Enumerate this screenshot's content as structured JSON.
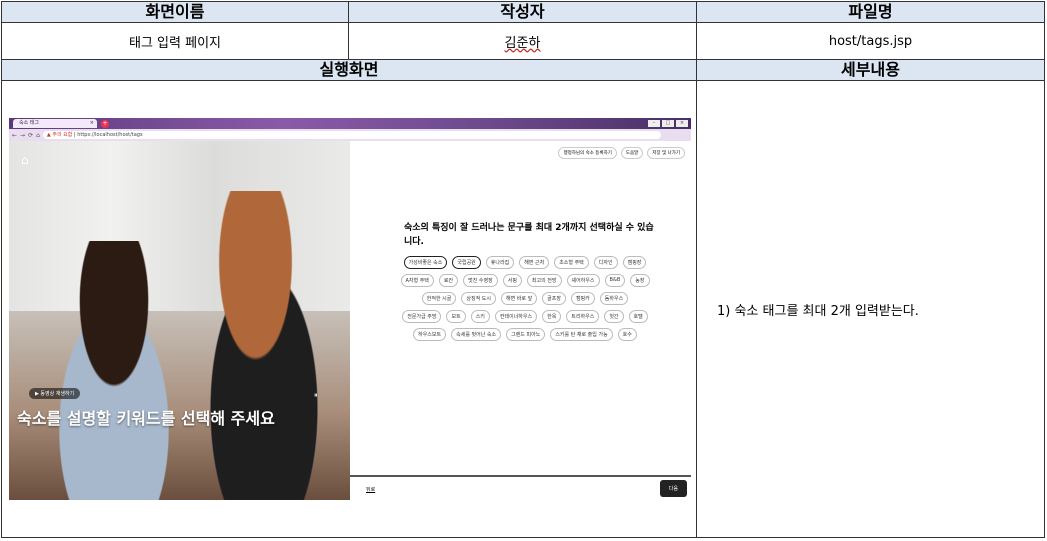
{
  "headers": {
    "screen_name": "화면이름",
    "author": "작성자",
    "file_name": "파일명",
    "screen_shot": "실행화면",
    "details": "세부내용"
  },
  "values": {
    "screen_name": "태그 입력 페이지",
    "author": "김준하",
    "file_name": "host/tags.jsp"
  },
  "details_text": "1) 숙소 태그를 최대 2개 입력받는다.",
  "browser": {
    "tab_title": "숙소 태그",
    "warning": "주의 요함",
    "url": "https://localhost/host/tags",
    "nav_icons": [
      "←",
      "→",
      "⟳",
      "⌂"
    ]
  },
  "page": {
    "logo": "⌂",
    "play_label": "▶ 동영상 재생하기",
    "pause_label": "⏸",
    "hero_text": "숙소를 설명할 키워드를 선택해 주세요",
    "top_pills": [
      "행정하님의 숙소 등록하기",
      "도움말",
      "저장 및 나가기"
    ],
    "question": "숙소의 특징이 잘 드러나는 문구를 최대 2개까지 선택하실 수 있습니다.",
    "chips": [
      "가성비좋은 숙소",
      "국립공원",
      "휴나라집",
      "해변 근처",
      "초소형 주택",
      "디자인",
      "캠핑장",
      "A자형 주택",
      "료칸",
      "멋진 수영장",
      "서핑",
      "최고의 전망",
      "셰어하우스",
      "B&B",
      "농장",
      "한적한 시골",
      "상징적 도시",
      "해변 바로 앞",
      "골프장",
      "캠핑카",
      "돔하우스",
      "전문가급 주방",
      "보트",
      "스키",
      "컨테이너하우스",
      "한옥",
      "트리하우스",
      "헛간",
      "호텔",
      "하우스보트",
      "속세를 벗어난 숙소",
      "그랜드 피아노",
      "스키를 탄 채로 출입 가능",
      "호수"
    ],
    "selected_chips": [
      0,
      1
    ],
    "back_label": "뒤로",
    "next_label": "다음"
  }
}
